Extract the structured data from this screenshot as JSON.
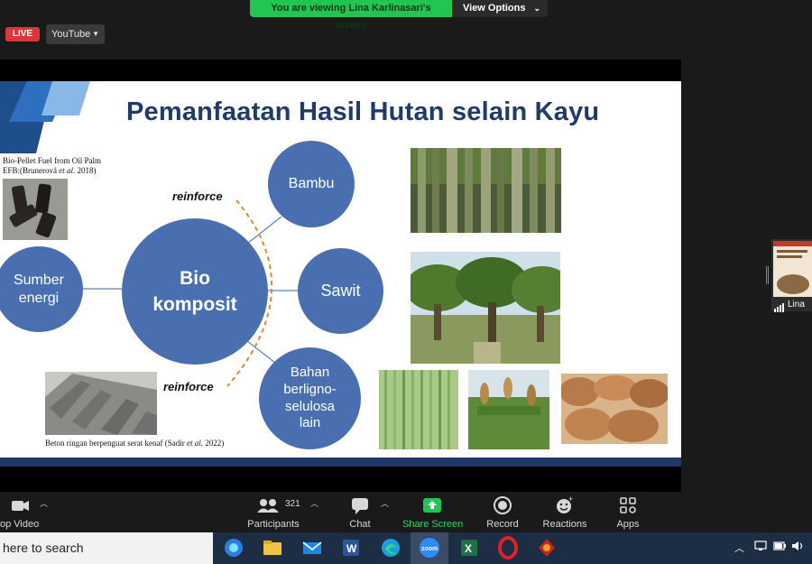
{
  "banner": {
    "viewing_text": "You are viewing Lina Karlinasari's screen",
    "view_options_label": "View Options"
  },
  "live_badge": "LIVE",
  "stream_target": "YouTube",
  "slide": {
    "title": "Pemanfaatan Hasil Hutan selain Kayu",
    "center_circle": {
      "line1": "Bio",
      "line2": "komposit"
    },
    "left_circle": {
      "line1": "Sumber",
      "line2": "energi"
    },
    "circles": {
      "bambu": "Bambu",
      "sawit": "Sawit",
      "bahan": [
        "Bahan",
        "berligno-",
        "selulosa",
        "lain"
      ]
    },
    "reinforce_top": "reinforce",
    "reinforce_bottom": "reinforce",
    "pellet_caption": {
      "line1": "Bio-Pellet Fuel from Oil Palm",
      "line2_a": "EFB:(Brunerová ",
      "line2_b": "et al",
      "line2_c": ". 2018)"
    },
    "beton_caption": {
      "a": "Beton ringan berpenguat serat kenaf (Sadir ",
      "b": "et al",
      "c": ". 2022)"
    },
    "brand_colors": {
      "circle": "#4a6fb0",
      "title": "#1f3b6a",
      "footer": "#1f3866"
    }
  },
  "participant_thumb": {
    "name": "Lina"
  },
  "toolbar": {
    "video": "op Video",
    "participants": "Participants",
    "participants_count": "321",
    "chat": "Chat",
    "share": "Share Screen",
    "record": "Record",
    "reactions": "Reactions",
    "apps": "Apps"
  },
  "taskbar": {
    "search_placeholder": "here to search",
    "apps": [
      "webex-icon",
      "file-explorer-icon",
      "mail-icon",
      "word-icon",
      "edge-icon",
      "zoom-icon",
      "excel-icon",
      "opera-icon",
      "game-icon"
    ]
  }
}
